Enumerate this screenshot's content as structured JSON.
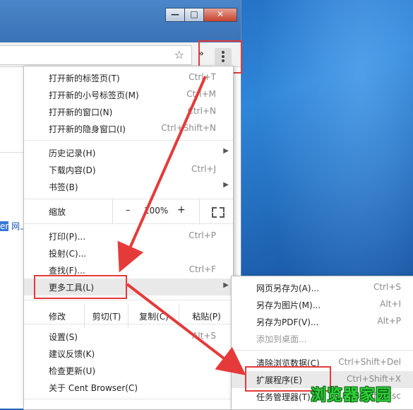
{
  "window": {
    "minimize": "—",
    "maximize": "□",
    "close": "✕"
  },
  "toolbar": {
    "star_icon": "☆",
    "chevron_icon": "»"
  },
  "page": {
    "snippet_sel": "er",
    "snippet_rest": " 网上"
  },
  "menu": {
    "new_tab": {
      "label": "打开新的标签页(T)",
      "shortcut": "Ctrl+T"
    },
    "new_small_tab": {
      "label": "打开新的小号标签页(M)",
      "shortcut": "Ctrl+M"
    },
    "new_window": {
      "label": "打开新的窗口(N)",
      "shortcut": "Ctrl+N"
    },
    "new_incognito": {
      "label": "打开新的隐身窗口(I)",
      "shortcut": "Ctrl+Shift+N"
    },
    "history": {
      "label": "历史记录(H)"
    },
    "downloads": {
      "label": "下载内容(D)",
      "shortcut": "Ctrl+J"
    },
    "bookmarks": {
      "label": "书签(B)"
    },
    "zoom": {
      "label": "缩放",
      "minus": "–",
      "value": "100%",
      "plus": "+"
    },
    "print": {
      "label": "打印(P)...",
      "shortcut": "Ctrl+P"
    },
    "cast": {
      "label": "投射(C)..."
    },
    "find": {
      "label": "查找(F)...",
      "shortcut": "Ctrl+F"
    },
    "more_tools": {
      "label": "更多工具(L)"
    },
    "edit": {
      "label": "修改",
      "cut": "剪切(T)",
      "copy": "复制(C)",
      "paste": "粘贴(P)"
    },
    "settings": {
      "label": "设置(S)",
      "shortcut": "Alt+S"
    },
    "feedback": {
      "label": "建议反馈(K)"
    },
    "update": {
      "label": "检查更新(U)"
    },
    "about": {
      "label": "关于 Cent Browser(C)"
    }
  },
  "submenu": {
    "save_page": {
      "label": "网页另存为(A)...",
      "shortcut": "Ctrl+S"
    },
    "save_image": {
      "label": "另存为图片(M)...",
      "shortcut": "Alt+I"
    },
    "save_pdf": {
      "label": "另存为PDF(V)...",
      "shortcut": "Alt+P"
    },
    "add_desktop": {
      "label": "添加到桌面..."
    },
    "clear_data": {
      "label": "清除浏览数据(C)",
      "shortcut": "Ctrl+Shift+Del"
    },
    "extensions": {
      "label": "扩展程序(E)",
      "shortcut": "Ctrl+Shift+X"
    },
    "task_manager": {
      "label": "任务管理器(T)",
      "shortcut": "Shift+Esc"
    }
  },
  "watermark": "浏览器家园",
  "colors": {
    "annotation": "#e53a3a",
    "desktop": "#2f86d8",
    "watermark": "#2fd03a"
  }
}
